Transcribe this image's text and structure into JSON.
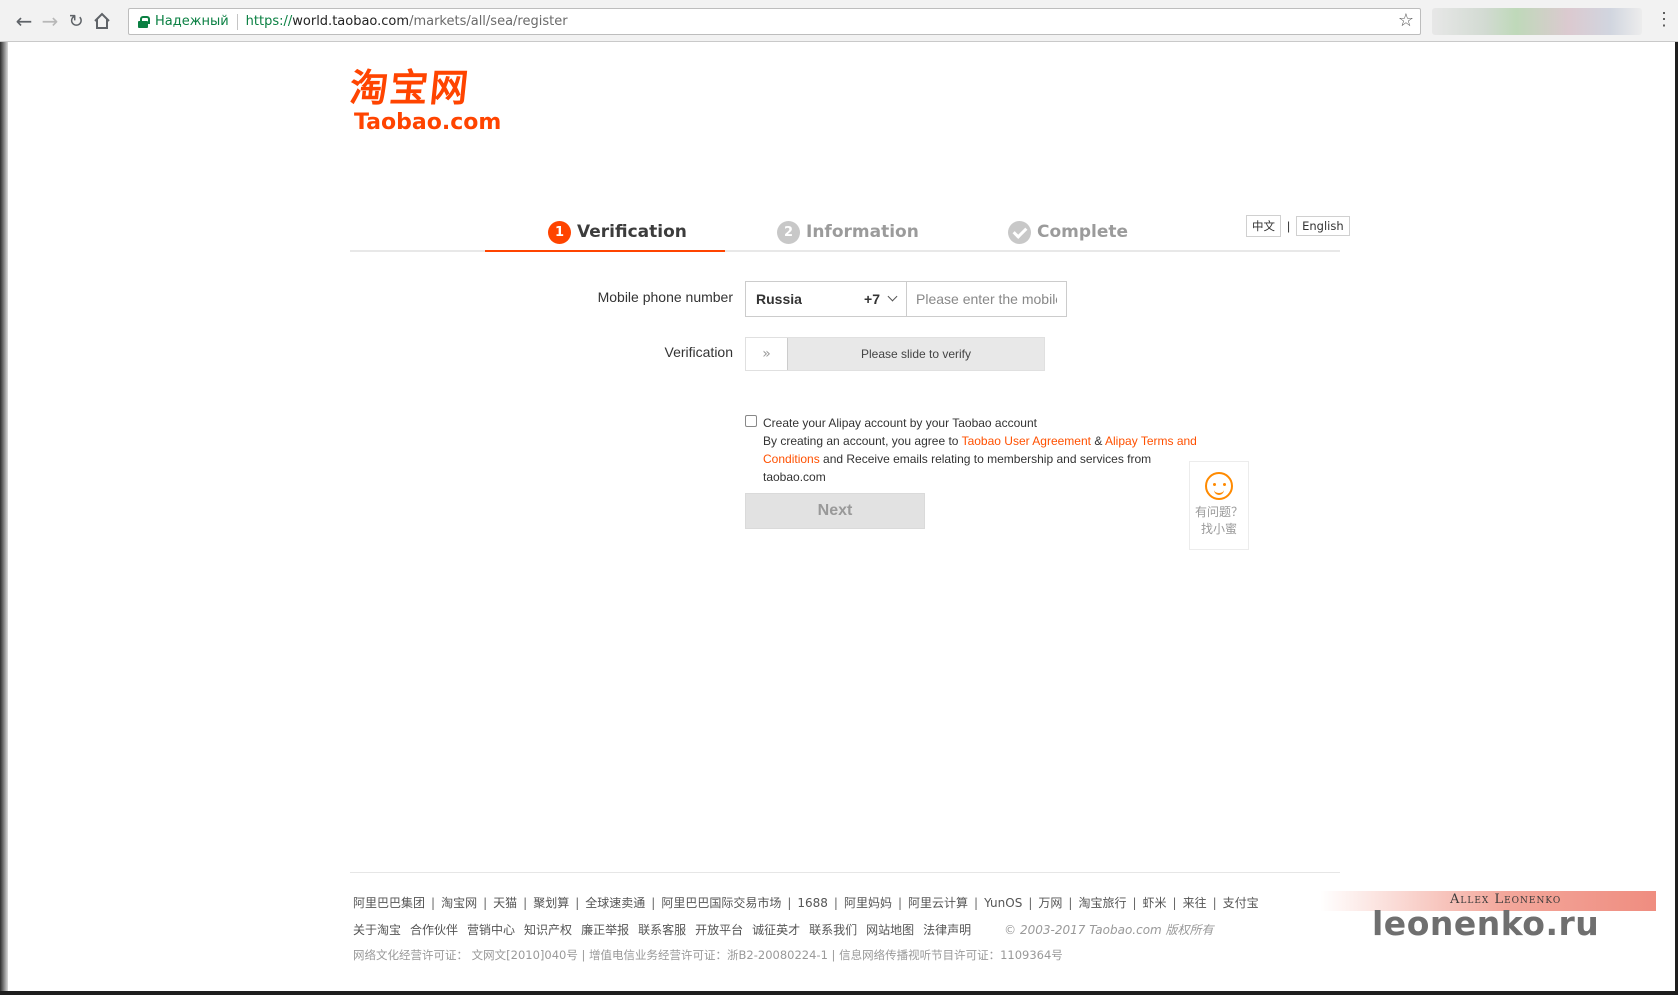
{
  "browser": {
    "secure_label": "Надежный",
    "url_scheme": "https://",
    "url_host": "world.taobao.com",
    "url_path": "/markets/all/sea/register"
  },
  "logo": {
    "cn": "淘宝网",
    "en": "Taobao.com"
  },
  "steps": [
    {
      "num": "1",
      "label": "Verification",
      "state": "active"
    },
    {
      "num": "2",
      "label": "Information",
      "state": "pending"
    },
    {
      "label": "Complete",
      "state": "pending"
    }
  ],
  "lang": {
    "zh": "中文",
    "sep": "|",
    "en": "English"
  },
  "form": {
    "phone_label": "Mobile phone number",
    "country": "Russia",
    "country_code": "+7",
    "phone_placeholder": "Please enter the mobile number",
    "verification_label": "Verification",
    "slider_text": "Please slide to verify",
    "agree_line1": "Create your Alipay account by your Taobao account",
    "agree_pre": "By creating an account, you agree to ",
    "link_user_agreement": "Taobao User Agreement",
    "agree_amp": " & ",
    "link_alipay_terms": "Alipay Terms and Conditions",
    "agree_post": " and Receive emails relating to membership and services from taobao.com",
    "next_label": "Next"
  },
  "helper": {
    "line1": "有问题？",
    "line2": "找小蜜"
  },
  "footer": {
    "row1": [
      "阿里巴巴集团",
      "淘宝网",
      "天猫",
      "聚划算",
      "全球速卖通",
      "阿里巴巴国际交易市场",
      "1688",
      "阿里妈妈",
      "阿里云计算",
      "YunOS",
      "万网",
      "淘宝旅行",
      "虾米",
      "来往",
      "支付宝"
    ],
    "row2": [
      "关于淘宝",
      "合作伙伴",
      "营销中心",
      "知识产权",
      "廉正举报",
      "联系客服",
      "开放平台",
      "诚征英才",
      "联系我们",
      "网站地图",
      "法律声明"
    ],
    "copyright": "© 2003-2017 Taobao.com 版权所有",
    "row3": "网络文化经营许可证： 文网文[2010]040号 | 增值电信业务经营许可证：浙B2-20080224-1 | 信息网络传播视听节目许可证：1109364号"
  },
  "watermark": {
    "name": "Allex Leonenko",
    "site": "leonenko.ru"
  },
  "colors": {
    "brand": "#ff4400",
    "link": "#ff5000",
    "secure": "#0b8043"
  }
}
